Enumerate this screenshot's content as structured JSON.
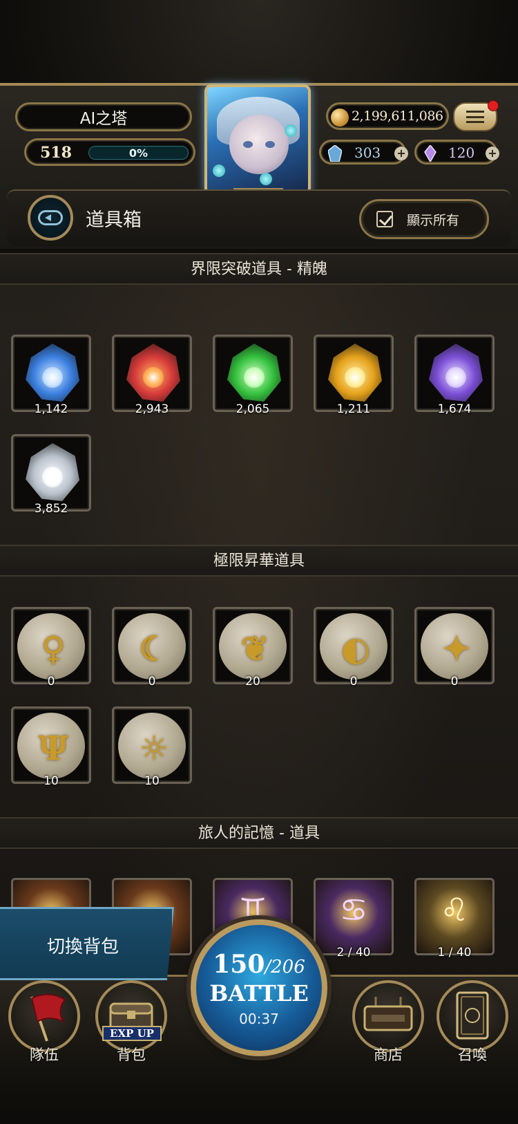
{
  "header": {
    "player_name": "AI之塔",
    "level": "518",
    "exp_percent": "0%",
    "gold": "2,199,611,086",
    "resource_1": "303",
    "resource_2": "120",
    "plus": "+"
  },
  "page": {
    "title": "道具箱",
    "show_all_label": "顯示所有"
  },
  "sections": [
    {
      "title": "界限突破道具 - 精魄",
      "items": [
        {
          "count": "1,142",
          "color": "#3b7fe0",
          "core": "#cfe6ff"
        },
        {
          "count": "2,943",
          "color": "#d63a3a",
          "core": "#ffb55a"
        },
        {
          "count": "2,065",
          "color": "#35c13e",
          "core": "#d2ffc4"
        },
        {
          "count": "1,211",
          "color": "#e5a11a",
          "core": "#fff0a4"
        },
        {
          "count": "1,674",
          "color": "#7b4fd6",
          "core": "#e7dcff"
        },
        {
          "count": "3,852",
          "color": "#b9c2cc",
          "core": "#ffffff"
        }
      ]
    },
    {
      "title": "極限昇華道具",
      "items": [
        {
          "count": "0",
          "glyph": "♀"
        },
        {
          "count": "0",
          "glyph": "☾"
        },
        {
          "count": "20",
          "glyph": "❦"
        },
        {
          "count": "0",
          "glyph": "◐"
        },
        {
          "count": "0",
          "glyph": "✦"
        },
        {
          "count": "10",
          "glyph": "Ψ"
        },
        {
          "count": "10",
          "glyph": "☼"
        }
      ]
    },
    {
      "title": "旅人的記憶 - 道具",
      "items": [
        {
          "count": "",
          "glyph": "",
          "tone": "#6b3a1c"
        },
        {
          "count": "",
          "glyph": "",
          "tone": "#6b3a1c"
        },
        {
          "count": "",
          "glyph": "♊",
          "tone": "#4a2a62"
        },
        {
          "count": "2 / 40",
          "glyph": "♋",
          "tone": "#4a2a62"
        },
        {
          "count": "1 / 40",
          "glyph": "♌",
          "tone": "#5d4a22"
        }
      ]
    }
  ],
  "bottom_nav": {
    "switch_bag": "切換背包",
    "team": "隊伍",
    "bag": "背包",
    "exp_up": "EXP UP",
    "shop": "商店",
    "summon": "召喚",
    "battle": {
      "stamina_current": "150",
      "stamina_sep": "/206",
      "label": "BATTLE",
      "timer": "00:37"
    }
  },
  "colors": {
    "frame_gold": "#a48a55",
    "battle_blue": "#165a96",
    "switch_blue": "#1b4d6b",
    "notification_red": "#e21f1f"
  }
}
